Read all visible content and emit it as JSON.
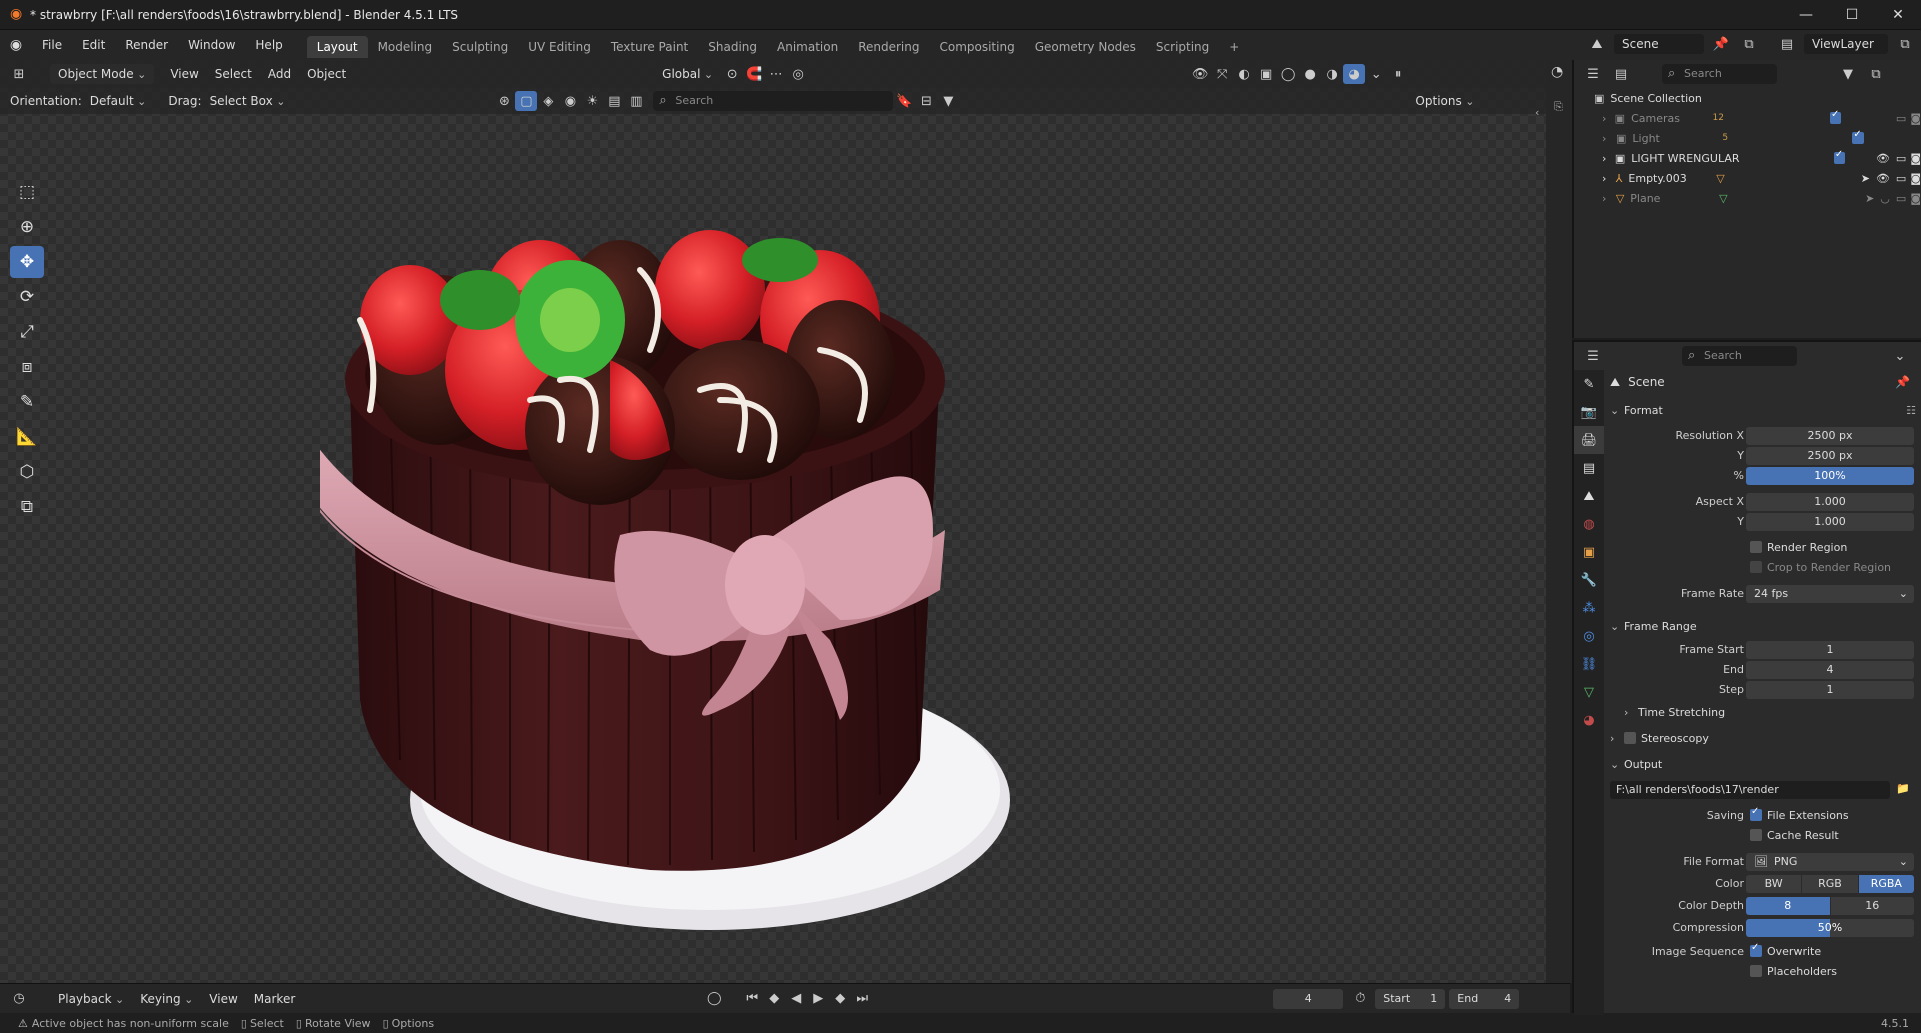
{
  "titlebar": {
    "title": "* strawbrry [F:\\all renders\\foods\\16\\strawbrry.blend] - Blender 4.5.1 LTS",
    "minimize": "—",
    "maximize": "☐",
    "close": "✕"
  },
  "menu": {
    "items": [
      "File",
      "Edit",
      "Render",
      "Window",
      "Help"
    ],
    "workspaces": [
      "Layout",
      "Modeling",
      "Sculpting",
      "UV Editing",
      "Texture Paint",
      "Shading",
      "Animation",
      "Rendering",
      "Compositing",
      "Geometry Nodes",
      "Scripting"
    ],
    "active_workspace": "Layout",
    "add_tab": "+",
    "scene": "Scene",
    "view_layer": "ViewLayer"
  },
  "viewport": {
    "mode": "Object Mode",
    "menus": [
      "View",
      "Select",
      "Add",
      "Object"
    ],
    "transform_orientation": "Global",
    "orientation_label": "Orientation:",
    "orientation_value": "Default",
    "drag_label": "Drag:",
    "drag_value": "Select Box",
    "search_placeholder": "Search",
    "options": "Options"
  },
  "timeline": {
    "menus": [
      "Playback",
      "Keying",
      "View",
      "Marker"
    ],
    "current_frame": "4",
    "start_label": "Start",
    "start_value": "1",
    "end_label": "End",
    "end_value": "4"
  },
  "statusbar": {
    "message": "Active object has non-uniform scale",
    "hints": [
      "Select",
      "Rotate View",
      "Options"
    ],
    "version": "4.5.1"
  },
  "outliner": {
    "search_placeholder": "Search",
    "root": "Scene Collection",
    "items": [
      {
        "name": "Cameras",
        "badge": "12",
        "dim": true
      },
      {
        "name": "Light",
        "badge": "5",
        "dim": true
      },
      {
        "name": "LIGHT WRENGULAR",
        "badge": "",
        "dim": false
      },
      {
        "name": "Empty.003",
        "badge": "",
        "dim": false
      },
      {
        "name": "Plane",
        "badge": "",
        "dim": true
      }
    ]
  },
  "properties": {
    "search_placeholder": "Search",
    "context": "Scene",
    "format": {
      "title": "Format",
      "resolution_x_label": "Resolution X",
      "resolution_x": "2500 px",
      "resolution_y_label": "Y",
      "resolution_y": "2500 px",
      "percent_label": "%",
      "percent": "100%",
      "aspect_x_label": "Aspect X",
      "aspect_x": "1.000",
      "aspect_y_label": "Y",
      "aspect_y": "1.000",
      "render_region": "Render Region",
      "crop_region": "Crop to Render Region",
      "frame_rate_label": "Frame Rate",
      "frame_rate": "24 fps"
    },
    "frame_range": {
      "title": "Frame Range",
      "start_label": "Frame Start",
      "start": "1",
      "end_label": "End",
      "end": "4",
      "step_label": "Step",
      "step": "1"
    },
    "time_stretching": "Time Stretching",
    "stereoscopy": "Stereoscopy",
    "output": {
      "title": "Output",
      "path": "F:\\all renders\\foods\\17\\render",
      "saving_label": "Saving",
      "file_extensions": "File Extensions",
      "cache_result": "Cache Result",
      "file_format_label": "File Format",
      "file_format": "PNG",
      "color_label": "Color",
      "color_options": [
        "BW",
        "RGB",
        "RGBA"
      ],
      "color_selected": "RGBA",
      "depth_label": "Color Depth",
      "depth_options": [
        "8",
        "16"
      ],
      "depth_selected": "8",
      "compression_label": "Compression",
      "compression": "50%",
      "image_sequence_label": "Image Sequence",
      "overwrite": "Overwrite",
      "placeholders": "Placeholders"
    }
  },
  "colors": {
    "accent": "#4772b3",
    "chocolate": "#3b1517",
    "ribbon": "#d79aa6",
    "strawberry": "#d9232b",
    "leaf": "#3d9a2e"
  }
}
